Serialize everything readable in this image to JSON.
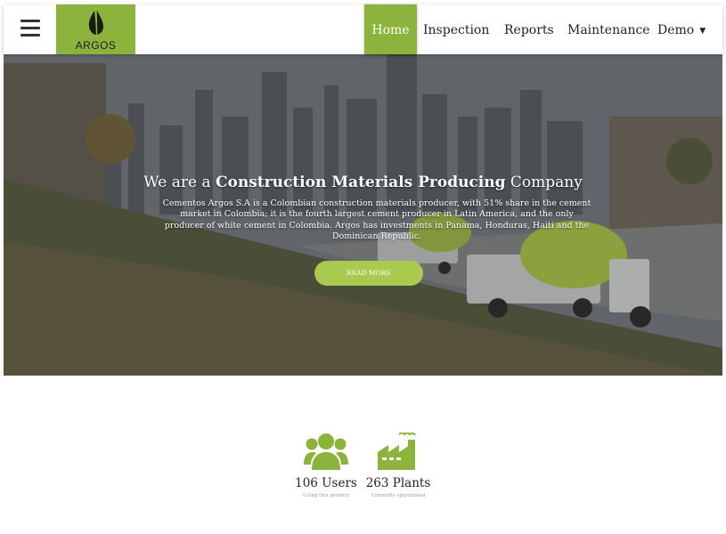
{
  "brand": {
    "name": "ARGOS",
    "color": "#8cb33b"
  },
  "nav": {
    "menu_icon": "hamburger-menu-icon",
    "items": [
      {
        "label": "Home",
        "active": true
      },
      {
        "label": "Inspection",
        "active": false
      },
      {
        "label": "Reports",
        "active": false
      },
      {
        "label": "Maintenance",
        "active": false
      },
      {
        "label": "Demo",
        "active": false,
        "dropdown": true
      }
    ],
    "dropdown_icon": "caret-down-icon"
  },
  "hero": {
    "title_prefix": "We are a ",
    "title_bold": "Construction Materials Producing",
    "title_suffix": " Company",
    "description": "Cementos Argos S.A is a Colombian construction materials producer, with 51% share in the cement market in Colombia; it is the fourth largest cement producer in Latin America, and the only producer of white cement in Colombia. Argos has investments in Panama, Honduras, Haiti and the Dominican Republic.",
    "button_label": "READ MORE"
  },
  "stats": [
    {
      "icon": "users-icon",
      "value": "106 Users",
      "caption": "Using this product"
    },
    {
      "icon": "factory-icon",
      "value": "263 Plants",
      "caption": "Currently operational"
    }
  ]
}
